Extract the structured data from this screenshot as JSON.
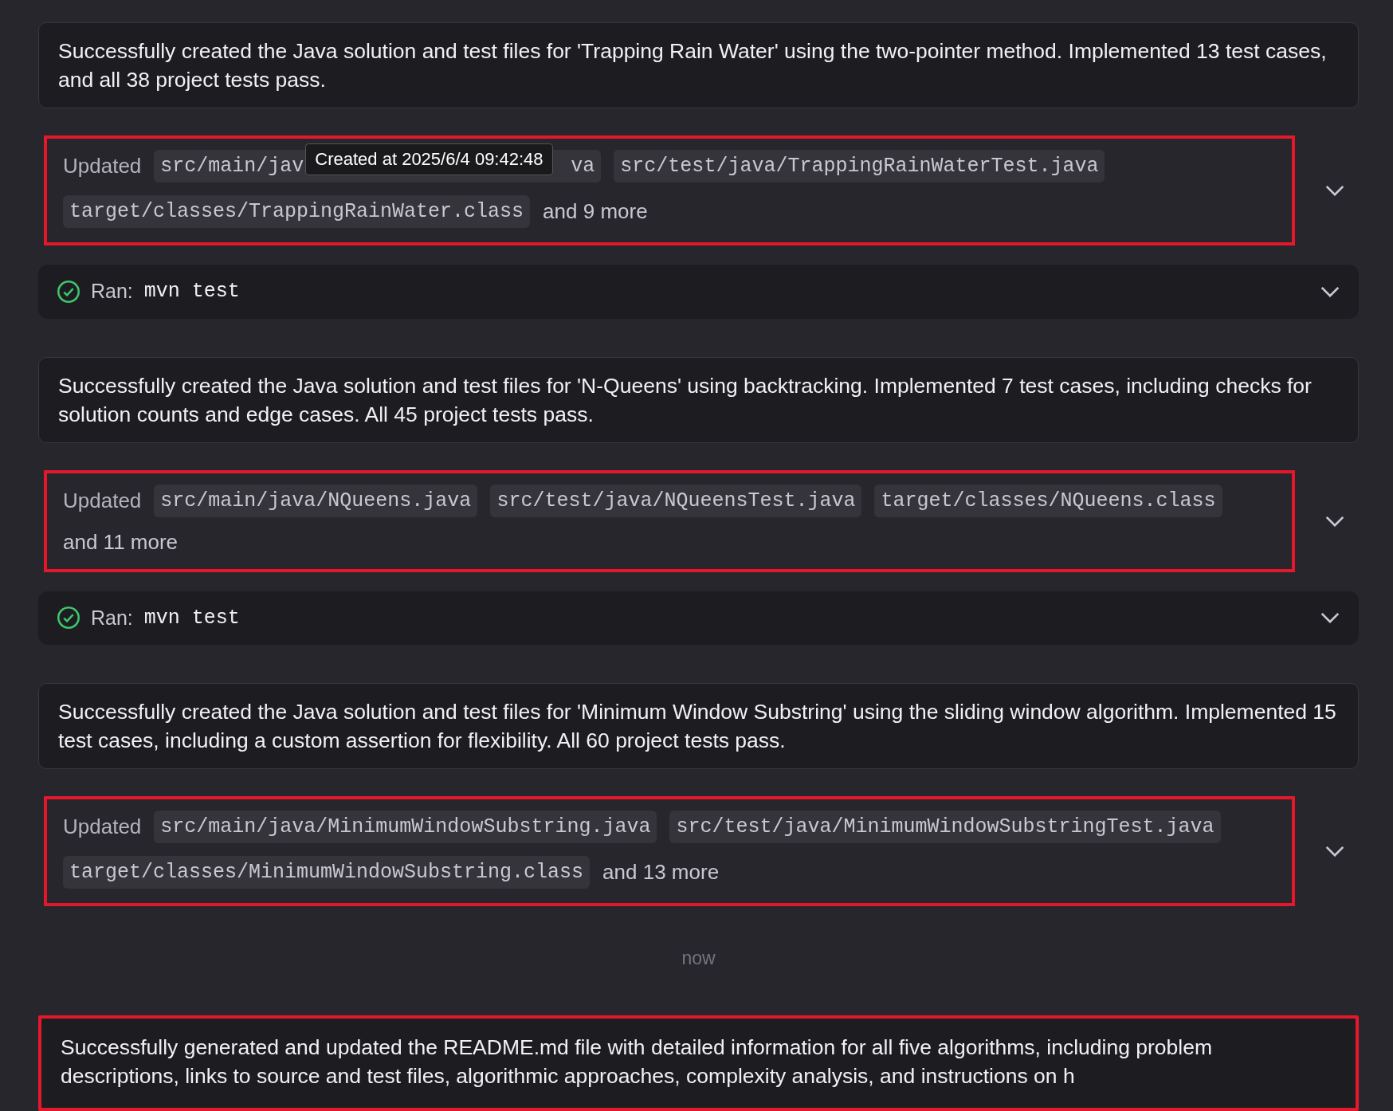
{
  "items": [
    {
      "kind": "message",
      "highlighted": false,
      "text": "Successfully created the Java solution and test files for 'Trapping Rain Water' using the two-pointer method. Implemented 13 test cases, and all 38 project tests pass."
    },
    {
      "kind": "files",
      "highlighted": true,
      "label": "Updated",
      "expanded": false,
      "files": [
        {
          "text": "src/main/jav",
          "hidden_tail": "va",
          "tooltip": "Created at 2025/6/4 09:42:48"
        },
        {
          "text": "src/test/java/TrappingRainWaterTest.java"
        },
        {
          "text": "target/classes/TrappingRainWater.class"
        }
      ],
      "more": "and 9 more"
    },
    {
      "kind": "command",
      "ok": true,
      "label": "Ran:",
      "command": "mvn test",
      "expanded": false
    },
    {
      "kind": "message",
      "highlighted": false,
      "text": "Successfully created the Java solution and test files for 'N-Queens' using backtracking. Implemented 7 test cases, including checks for solution counts and edge cases. All 45 project tests pass."
    },
    {
      "kind": "files",
      "highlighted": true,
      "label": "Updated",
      "expanded": false,
      "files": [
        {
          "text": "src/main/java/NQueens.java"
        },
        {
          "text": "src/test/java/NQueensTest.java"
        },
        {
          "text": "target/classes/NQueens.class"
        }
      ],
      "more": "and 11 more"
    },
    {
      "kind": "command",
      "ok": true,
      "label": "Ran:",
      "command": "mvn test",
      "expanded": false
    },
    {
      "kind": "message",
      "highlighted": false,
      "text": "Successfully created the Java solution and test files for 'Minimum Window Substring' using the sliding window algorithm. Implemented 15 test cases, including a custom assertion for flexibility. All 60 project tests pass."
    },
    {
      "kind": "files",
      "highlighted": true,
      "label": "Updated",
      "expanded": false,
      "files": [
        {
          "text": "src/main/java/MinimumWindowSubstring.java"
        },
        {
          "text": "src/test/java/MinimumWindowSubstringTest.java"
        },
        {
          "text": "target/classes/MinimumWindowSubstring.class"
        }
      ],
      "more": "and 13 more"
    },
    {
      "kind": "timestamp",
      "text": "now"
    },
    {
      "kind": "message",
      "highlighted": true,
      "text": "Successfully generated and updated the README.md file with detailed information for all five algorithms, including problem descriptions, links to source and test files, algorithmic approaches, complexity analysis, and instructions on h"
    }
  ]
}
